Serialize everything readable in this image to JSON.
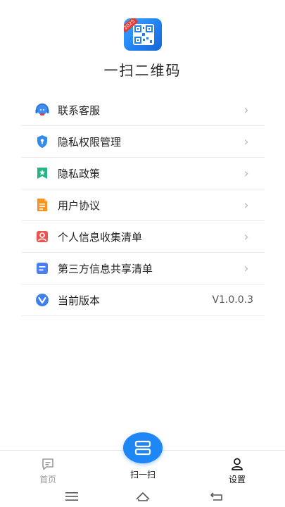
{
  "app": {
    "badge_text": "2025",
    "title": "一扫二维码"
  },
  "menu": {
    "items": [
      {
        "label": "联系客服",
        "icon": "headset-icon"
      },
      {
        "label": "隐私权限管理",
        "icon": "shield-icon"
      },
      {
        "label": "隐私政策",
        "icon": "bookmark-star-icon"
      },
      {
        "label": "用户协议",
        "icon": "document-icon"
      },
      {
        "label": "个人信息收集清单",
        "icon": "person-card-icon"
      },
      {
        "label": "第三方信息共享清单",
        "icon": "list-doc-icon"
      },
      {
        "label": "当前版本",
        "icon": "version-v-icon",
        "value": "V1.0.0.3"
      }
    ]
  },
  "tabbar": {
    "home_label": "首页",
    "scan_label": "扫一扫",
    "settings_label": "设置"
  },
  "colors": {
    "accent": "#1e86f5",
    "divider": "#ececec",
    "inactive_tab": "#9a9a9a"
  }
}
